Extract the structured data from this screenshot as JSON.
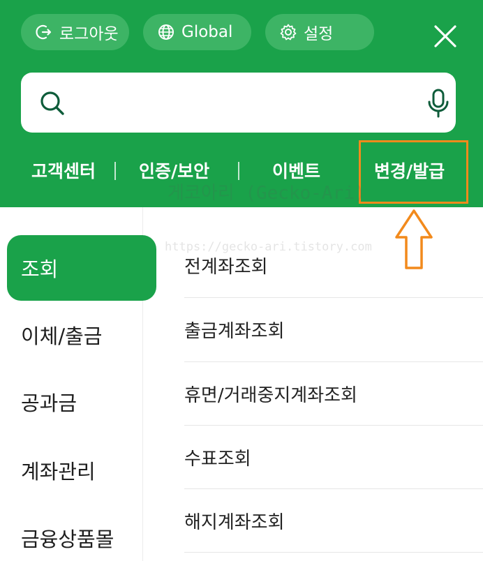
{
  "header": {
    "pills": [
      {
        "label": "로그아웃",
        "icon": "logout-icon"
      },
      {
        "label": "Global",
        "icon": "globe-icon"
      },
      {
        "label": "설정",
        "icon": "gear-icon"
      }
    ],
    "close_icon": "close-icon",
    "background_color": "#1aa24a"
  },
  "search": {
    "placeholder": "",
    "value": "",
    "search_icon": "search-icon",
    "mic_icon": "microphone-icon"
  },
  "quick_links": [
    "고객센터",
    "인증/보안",
    "이벤트",
    "변경/발급"
  ],
  "highlight_color": "#f28a1c",
  "watermark": {
    "line1": "게코아리 (Gecko-Ari)",
    "line2": "https://gecko-ari.tistory.com"
  },
  "left_menu": {
    "items": [
      "조회",
      "이체/출금",
      "공과금",
      "계좌관리",
      "금융상품몰"
    ],
    "active_index": 0
  },
  "sub_menu": {
    "items": [
      "전계좌조회",
      "출금계좌조회",
      "휴면/거래중지계좌조회",
      "수표조회",
      "해지계좌조회"
    ]
  }
}
